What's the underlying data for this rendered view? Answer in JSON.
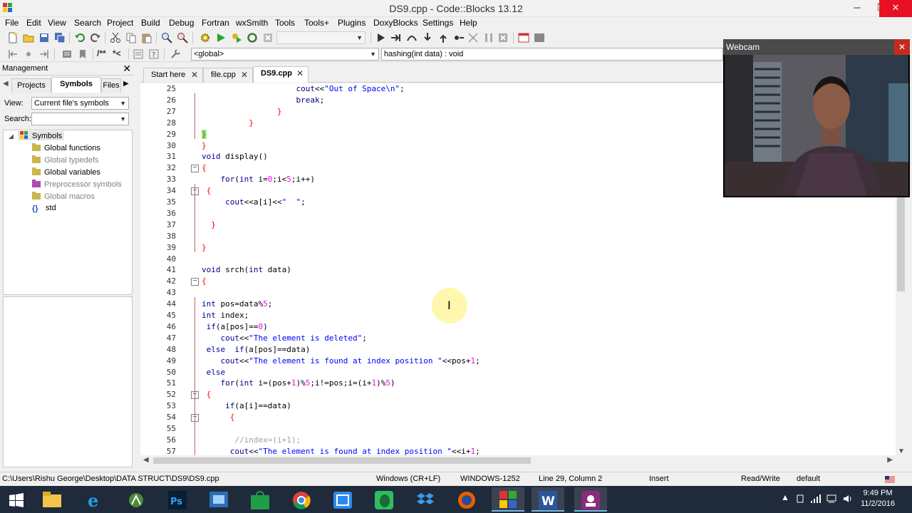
{
  "window": {
    "title": "DS9.cpp - Code::Blocks 13.12",
    "minimize": "─",
    "maximize": "❐",
    "close": "✕"
  },
  "menu": [
    "File",
    "Edit",
    "View",
    "Search",
    "Project",
    "Build",
    "Debug",
    "Fortran",
    "wxSmith",
    "Tools",
    "Tools+",
    "Plugins",
    "DoxyBlocks",
    "Settings",
    "Help"
  ],
  "toolbar": {
    "doxy_comment": "/**",
    "doxy_inline": "*<",
    "scope_combo": "<global>",
    "function_combo": "hashing(int data) : void"
  },
  "management": {
    "title": "Management",
    "close": "✕",
    "tabs": [
      "Projects",
      "Symbols",
      "Files"
    ],
    "active_tab": "Symbols",
    "view_label": "View:",
    "view_value": "Current file's symbols",
    "search_label": "Search:",
    "search_value": "",
    "tree": {
      "root": "Symbols",
      "items": [
        {
          "label": "Global functions",
          "dim": false
        },
        {
          "label": "Global typedefs",
          "dim": true
        },
        {
          "label": "Global variables",
          "dim": false
        },
        {
          "label": "Preprocessor symbols",
          "dim": true
        },
        {
          "label": "Global macros",
          "dim": true
        },
        {
          "label": "std",
          "dim": false
        }
      ]
    }
  },
  "editor_tabs": [
    {
      "label": "Start here",
      "active": false
    },
    {
      "label": "file.cpp",
      "active": false
    },
    {
      "label": "DS9.cpp",
      "active": true
    }
  ],
  "code": {
    "first_line": 25,
    "lines": [
      "                    cout<<\"Out of Space\\n\";",
      "                    break;",
      "                }",
      "          }",
      "}",
      "}",
      "void display()",
      "{",
      "    for(int i=0;i<5;i++)",
      " {",
      "     cout<<a[i]<<\"  \";",
      "",
      "  }",
      "",
      "}",
      "",
      "void srch(int data)",
      "{",
      "",
      "int pos=data%5;",
      "int index;",
      " if(a[pos]==0)",
      "    cout<<\"The element is deleted\";",
      " else  if(a[pos]==data)",
      "    cout<<\"The element is found at index position \"<<pos+1;",
      " else",
      "    for(int i=(pos+1)%5;i!=pos;i=(i+1)%5)",
      " {",
      "     if(a[i]==data)",
      "      {",
      "",
      "       //index=(i+1);",
      "      cout<<\"The element is found at index position \"<<i+1;"
    ]
  },
  "status": {
    "path": "C:\\Users\\Rishu George\\Desktop\\DATA STRUCT\\DS9\\DS9.cpp",
    "eol": "Windows (CR+LF)",
    "encoding": "WINDOWS-1252",
    "position": "Line 29, Column 2",
    "mode": "Insert",
    "access": "Read/Write",
    "theme": "default"
  },
  "webcam": {
    "title": "Webcam",
    "close": "✕"
  },
  "taskbar": {
    "time": "9:49 PM",
    "date": "11/2/2016"
  },
  "colors": {
    "keyword": "#00008b",
    "string": "#0000ff",
    "number": "#ff00ff",
    "operator": "#ff0000",
    "comment": "#a0a0a0",
    "taskbar": "#1f2a3a"
  }
}
